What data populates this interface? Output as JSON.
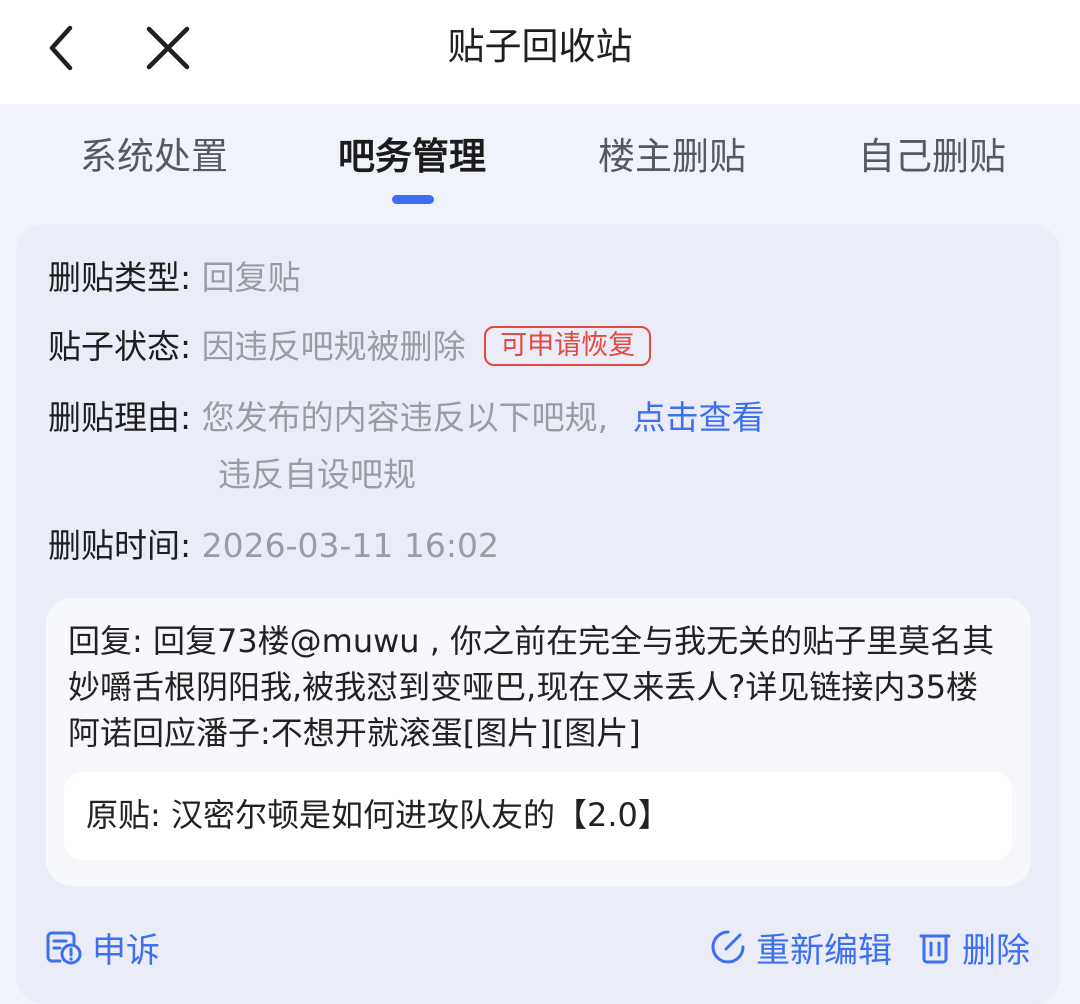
{
  "header": {
    "title": "贴子回收站",
    "back_icon": "chevron-left-icon",
    "close_icon": "close-icon"
  },
  "tabs": [
    {
      "label": "系统处置",
      "active": false
    },
    {
      "label": "吧务管理",
      "active": true
    },
    {
      "label": "楼主删贴",
      "active": false
    },
    {
      "label": "自己删贴",
      "active": false
    }
  ],
  "detail": {
    "type_label": "删贴类型:",
    "type_value": "回复贴",
    "status_label": "贴子状态:",
    "status_value": "因违反吧规被删除",
    "status_badge": "可申请恢复",
    "reason_label": "删贴理由:",
    "reason_value": "您发布的内容违反以下吧规,",
    "reason_link": "点击查看",
    "reason_rule": "违反自设吧规",
    "time_label": "删贴时间:",
    "time_value": "2026-03-11 16:02"
  },
  "reply": {
    "text": "回复: 回复73楼@muwu , 你之前在完全与我无关的贴子里莫名其妙嚼舌根阴阳我,被我怼到变哑巴,现在又来丢人?详见链接内35楼阿诺回应潘子:不想开就滚蛋[图片][图片]",
    "original_post": "原贴: 汉密尔顿是如何进攻队友的【2.0】"
  },
  "actions": {
    "appeal": "申诉",
    "reedit": "重新编辑",
    "delete": "删除"
  },
  "colors": {
    "accent": "#3d6ff0",
    "badge_red": "#e6473f",
    "background": "#f1f3fa"
  }
}
